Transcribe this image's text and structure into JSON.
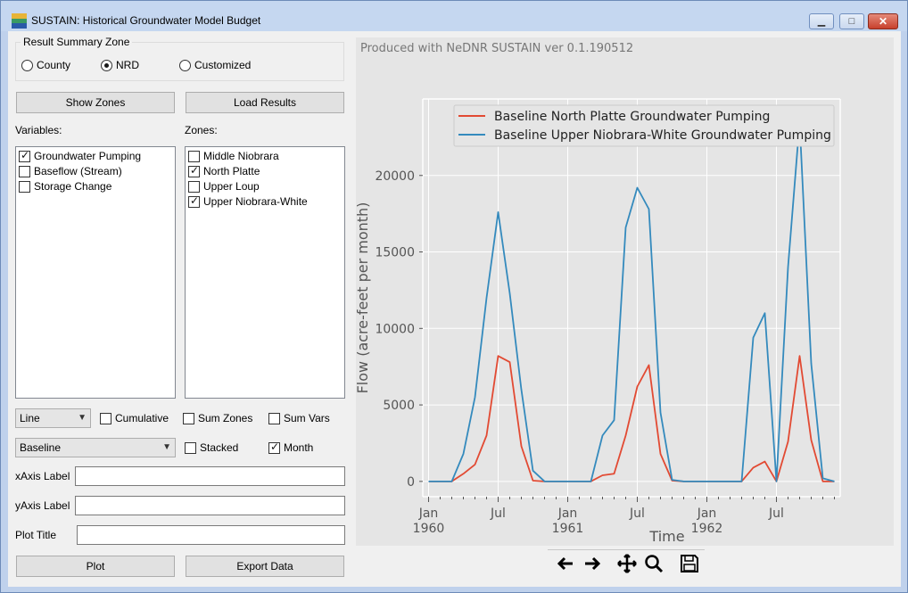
{
  "window": {
    "title": "SUSTAIN: Historical Groundwater Model Budget",
    "minimize_glyph": "▁",
    "maximize_glyph": "□",
    "close_glyph": "✕"
  },
  "summary_zone": {
    "title": "Result Summary Zone",
    "options": [
      "County",
      "NRD",
      "Customized"
    ],
    "selected": "NRD"
  },
  "buttons": {
    "show_zones": "Show Zones",
    "load_results": "Load Results",
    "plot": "Plot",
    "export_data": "Export Data"
  },
  "variables": {
    "label": "Variables:",
    "items": [
      {
        "label": "Groundwater Pumping",
        "checked": true
      },
      {
        "label": "Baseflow (Stream)",
        "checked": false
      },
      {
        "label": "Storage Change",
        "checked": false
      }
    ]
  },
  "zones": {
    "label": "Zones:",
    "items": [
      {
        "label": "Middle Niobrara",
        "checked": false
      },
      {
        "label": "North Platte",
        "checked": true
      },
      {
        "label": "Upper Loup",
        "checked": false
      },
      {
        "label": "Upper Niobrara-White",
        "checked": true
      }
    ]
  },
  "options": {
    "plot_type": "Line",
    "scenario": "Baseline",
    "cumulative": {
      "label": "Cumulative",
      "checked": false
    },
    "sum_zones": {
      "label": "Sum Zones",
      "checked": false
    },
    "sum_vars": {
      "label": "Sum Vars",
      "checked": false
    },
    "stacked": {
      "label": "Stacked",
      "checked": false
    },
    "month": {
      "label": "Month",
      "checked": true
    }
  },
  "fields": {
    "x_axis_label": {
      "label": "xAxis Label",
      "value": ""
    },
    "y_axis_label": {
      "label": "yAxis Label",
      "value": ""
    },
    "plot_title": {
      "label": "Plot Title",
      "value": ""
    }
  },
  "plot": {
    "produced_text": "Produced with NeDNR SUSTAIN ver 0.1.190512"
  },
  "chart_data": {
    "type": "line",
    "title": "",
    "xlabel": "Time",
    "ylabel": "Flow (acre-feet per month)",
    "ylim": [
      -1000,
      25000
    ],
    "yticks": [
      0,
      5000,
      10000,
      15000,
      20000
    ],
    "x_tick_labels": [
      {
        "month": 0,
        "line1": "Jan",
        "line2": "1960"
      },
      {
        "month": 6,
        "line1": "Jul",
        "line2": ""
      },
      {
        "month": 12,
        "line1": "Jan",
        "line2": "1961"
      },
      {
        "month": 18,
        "line1": "Jul",
        "line2": ""
      },
      {
        "month": 24,
        "line1": "Jan",
        "line2": "1962"
      },
      {
        "month": 30,
        "line1": "Jul",
        "line2": ""
      }
    ],
    "legend_position": "top-right",
    "grid": true,
    "x_months": [
      0,
      1,
      2,
      3,
      4,
      5,
      6,
      7,
      8,
      9,
      10,
      11,
      12,
      13,
      14,
      15,
      16,
      17,
      18,
      19,
      20,
      21,
      22,
      23,
      24,
      25,
      26,
      27,
      28,
      29,
      30,
      31,
      32,
      33,
      34,
      35
    ],
    "series": [
      {
        "name": "Baseline North Platte Groundwater Pumping",
        "color": "#e24a33",
        "values": [
          0,
          0,
          0,
          500,
          1100,
          3000,
          8200,
          7800,
          2300,
          50,
          0,
          0,
          0,
          0,
          0,
          400,
          500,
          3000,
          6200,
          7600,
          1800,
          50,
          0,
          0,
          0,
          0,
          0,
          0,
          900,
          1300,
          0,
          2600,
          8200,
          2700,
          0,
          0
        ]
      },
      {
        "name": "Baseline Upper Niobrara-White Groundwater Pumping",
        "color": "#348abd",
        "values": [
          0,
          0,
          0,
          1800,
          5500,
          12000,
          17600,
          12300,
          6000,
          700,
          0,
          0,
          0,
          0,
          0,
          3000,
          4000,
          16600,
          19200,
          17800,
          4500,
          100,
          0,
          0,
          0,
          0,
          0,
          0,
          9400,
          11000,
          0,
          14000,
          23500,
          7700,
          200,
          0
        ]
      }
    ]
  },
  "toolbar_icons": [
    "back-arrow-icon",
    "forward-arrow-icon",
    "pan-icon",
    "zoom-icon",
    "save-icon"
  ]
}
